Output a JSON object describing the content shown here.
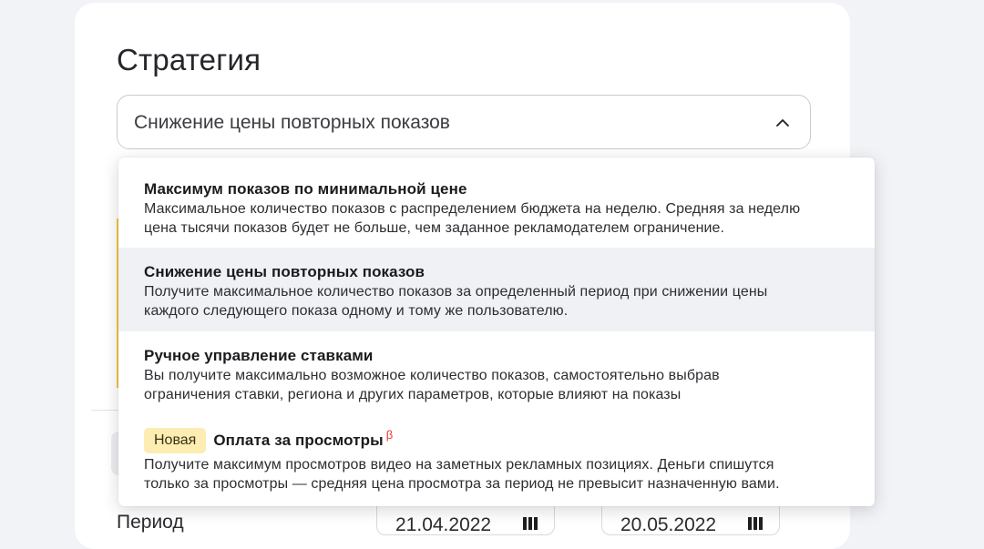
{
  "page": {
    "title": "Стратегия"
  },
  "select": {
    "value": "Снижение цены повторных показов",
    "icon": "chevron-up-icon"
  },
  "dropdown": {
    "options": [
      {
        "title": "Максимум показов по минимальной цене",
        "description_lines": [
          "Максимальное количество показов с распределением бюджета на неделю. Средняя за неделю",
          "цена тысячи показов будет не больше, чем заданное рекламодателем ограничение."
        ],
        "selected": false
      },
      {
        "title": "Снижение цены повторных показов",
        "description_lines": [
          "Получите максимальное количество показов за определенный период при снижении цены",
          "каждого следующего показа одному и тому же пользователю."
        ],
        "selected": true
      },
      {
        "title": "Ручное управление ставками",
        "description_lines": [
          "Вы получите максимально возможное количество показов, самостоятельно выбрав",
          "ограничения ставки, региона и других параметров, которые влияют на показы"
        ],
        "selected": false
      },
      {
        "badge": "Новая",
        "title": "Оплата за просмотры",
        "beta_mark": "β",
        "description_lines": [
          "Получите максимум просмотров видео на заметных рекламных позициях. Деньги спишутся",
          "только за просмотры — средняя цена просмотра за период не превысит назначенную вами."
        ],
        "selected": false
      }
    ]
  },
  "background": {
    "period_label": "Период",
    "date_from": "21.04.2022",
    "date_to": "20.05.2022",
    "date_icon": "calendar-icon"
  },
  "colors": {
    "page_bg": "#f2f3f7",
    "card_bg": "#ffffff",
    "selected_option_bg": "#f0f1f4",
    "badge_bg": "#fdedb3",
    "beta_color": "#e8392f",
    "accent_yellow": "#f4c842"
  }
}
